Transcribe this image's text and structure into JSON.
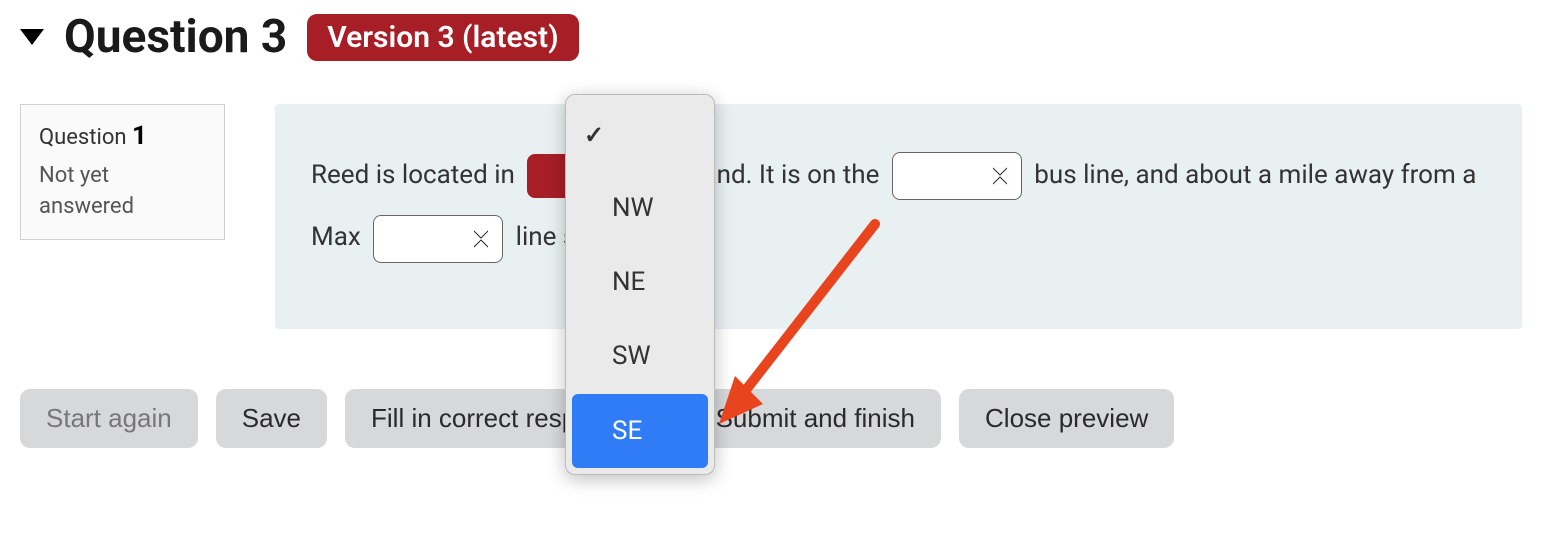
{
  "header": {
    "title": "Question 3",
    "version_badge": "Version 3 (latest)"
  },
  "question_info": {
    "label": "Question",
    "number": "1",
    "status": "Not yet answered"
  },
  "question_text": {
    "part1": "Reed is located in ",
    "part2": "ortland. It is on the ",
    "part3": " bus line, and about a mile away from a Max ",
    "part4": " line stop"
  },
  "dropdown": {
    "options": [
      {
        "label": "",
        "blank": true,
        "highlighted": false,
        "checked": true
      },
      {
        "label": "NW",
        "blank": false,
        "highlighted": false,
        "checked": false
      },
      {
        "label": "NE",
        "blank": false,
        "highlighted": false,
        "checked": false
      },
      {
        "label": "SW",
        "blank": false,
        "highlighted": false,
        "checked": false
      },
      {
        "label": "SE",
        "blank": false,
        "highlighted": true,
        "checked": false
      }
    ]
  },
  "buttons": {
    "start_again": "Start again",
    "save": "Save",
    "fill_correct": "Fill in correct responses",
    "submit": "Submit and finish",
    "close": "Close preview"
  }
}
